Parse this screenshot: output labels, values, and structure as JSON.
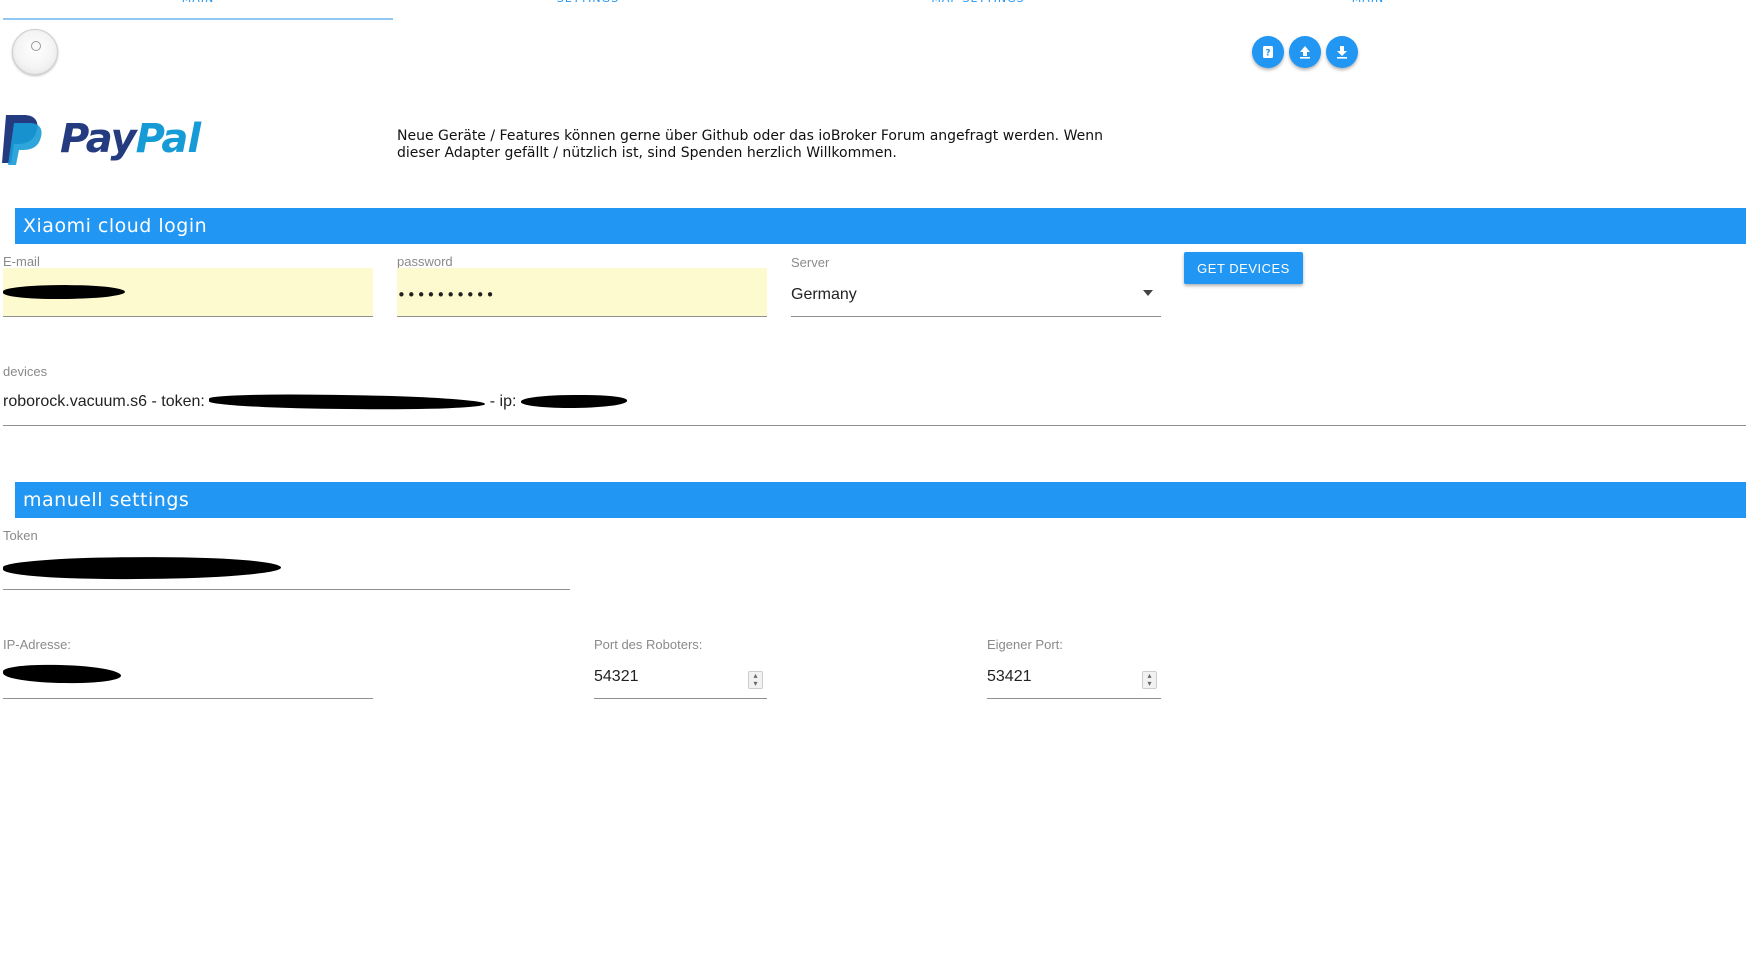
{
  "tabs": [
    {
      "label": "MAIN"
    },
    {
      "label": "SETTINGS"
    },
    {
      "label": "MAP SETTINGS"
    },
    {
      "label": "MAIN"
    }
  ],
  "toolbar": {
    "help_icon": "help-icon",
    "upload_icon": "upload-icon",
    "download_icon": "download-icon"
  },
  "donation": {
    "brand": "PayPal",
    "text": "Neue Geräte / Features können gerne über Github oder das ioBroker Forum angefragt werden. Wenn dieser Adapter gefällt / nützlich ist, sind Spenden herzlich Willkommen."
  },
  "cloud_login": {
    "title": "Xiaomi cloud login",
    "email_label": "E-mail",
    "password_label": "password",
    "password_value": "••••••••••",
    "server_label": "Server",
    "server_value": "Germany",
    "get_devices_label": "GET DEVICES",
    "devices_label": "devices",
    "device_prefix": "roborock.vacuum.s6 - token:",
    "device_ip_prefix": "- ip:"
  },
  "manual": {
    "title": "manuell settings",
    "token_label": "Token",
    "ip_label": "IP-Adresse:",
    "robot_port_label": "Port des Roboters:",
    "robot_port_value": "54321",
    "own_port_label": "Eigener Port:",
    "own_port_value": "53421"
  },
  "colors": {
    "accent": "#2196f3",
    "autofill": "#fdfacf",
    "paypal_dark": "#253b80",
    "paypal_light": "#179bd7"
  }
}
